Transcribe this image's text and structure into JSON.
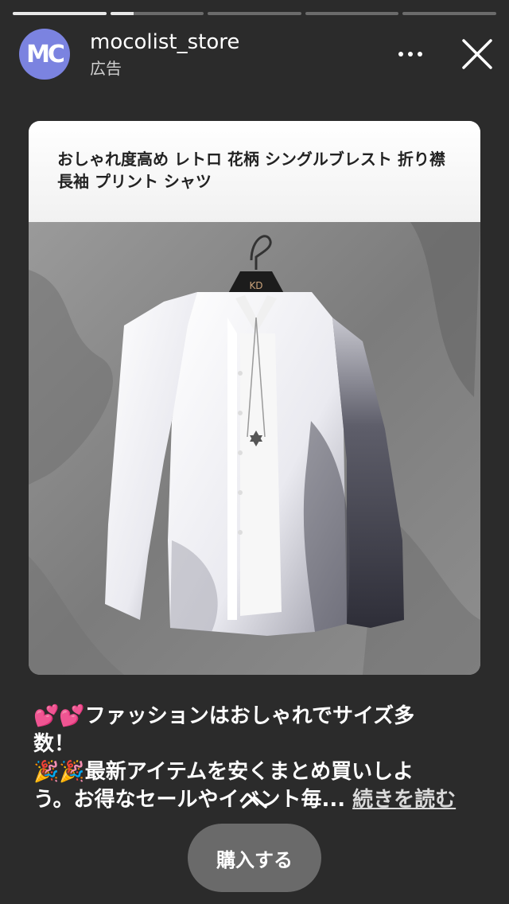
{
  "story": {
    "progress": [
      1.0,
      0.25,
      0.0,
      0.0,
      0.0
    ]
  },
  "header": {
    "avatar_text": "MC",
    "username": "mocolist_store",
    "sublabel": "広告",
    "more_icon": "more-horizontal-icon",
    "close_icon": "close-icon"
  },
  "card": {
    "title": "おしゃれ度高め レトロ 花柄 シングルブレスト 折り襟 長袖 プリント シャツ",
    "image": {
      "description_icon": "product-photo",
      "hanger_label": "KD"
    }
  },
  "caption": {
    "line1": "💕💕ファッションはおしゃれでサイズ多",
    "line2": "数！",
    "line3": "🎉🎉最新アイテムを安くまとめ買いしよ",
    "line4": "う。お得なセールやイベント毎...",
    "more_label": "続きを読む"
  },
  "cta": {
    "label": "購入する",
    "swipe_icon": "chevron-up-icon"
  },
  "colors": {
    "background": "#2b2b2b",
    "avatar": "#7b83e0",
    "cta": "#6a6a6a"
  }
}
